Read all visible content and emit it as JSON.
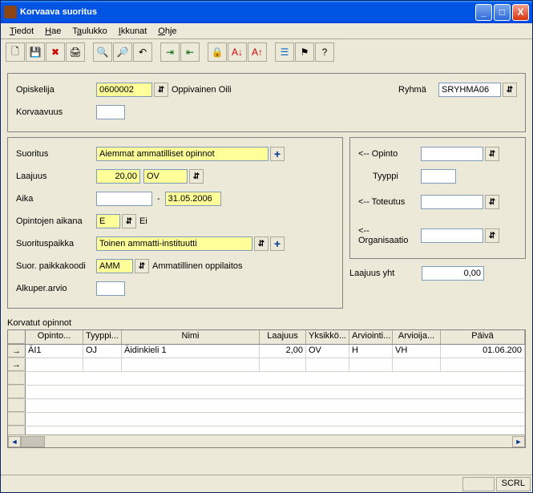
{
  "window": {
    "title": "Korvaava suoritus"
  },
  "menu": {
    "tiedot": "Tiedot",
    "hae": "Hae",
    "taulukko": "Taulukko",
    "ikkunat": "Ikkunat",
    "ohje": "Ohje"
  },
  "top": {
    "opiskelija_lbl": "Opiskelija",
    "opiskelija_val": "0600002",
    "opiskelija_name": "Oppivainen Oili",
    "ryhma_lbl": "Ryhmä",
    "ryhma_val": "SRYHMÄ06",
    "korvaavuus_lbl": "Korvaavuus",
    "korvaavuus_val": ""
  },
  "left": {
    "suoritus_lbl": "Suoritus",
    "suoritus_val": "Aiemmat ammatilliset opinnot",
    "laajuus_lbl": "Laajuus",
    "laajuus_val": "20,00",
    "laajuus_unit": "OV",
    "aika_lbl": "Aika",
    "aika_from": "",
    "aika_sep": "-",
    "aika_to": "31.05.2006",
    "opintojen_lbl": "Opintojen aikana",
    "opintojen_val": "E",
    "opintojen_txt": "Ei",
    "suorituspaikka_lbl": "Suorituspaikka",
    "suorituspaikka_val": "Toinen ammatti-instituutti",
    "paikkakoodi_lbl": "Suor. paikkakoodi",
    "paikkakoodi_val": "AMM",
    "paikkakoodi_txt": "Ammatillinen oppilaitos",
    "alkuper_lbl": "Alkuper.arvio",
    "alkuper_val": ""
  },
  "right": {
    "opinto_lbl": "<-- Opinto",
    "opinto_val": "",
    "tyyppi_lbl": "Tyyppi",
    "tyyppi_val": "",
    "toteutus_lbl": "<-- Toteutus",
    "toteutus_val": "",
    "organisaatio_lbl": "<-- Organisaatio",
    "organisaatio_val": "",
    "laajuus_yht_lbl": "Laajuus yht",
    "laajuus_yht_val": "0,00"
  },
  "table": {
    "title": "Korvatut opinnot",
    "cols": [
      "Opinto...",
      "Tyyppi...",
      "Nimi",
      "Laajuus",
      "Yksikkö...",
      "Arviointi...",
      "Arvioija...",
      "Päivä"
    ],
    "rows": [
      {
        "opinto": "ÄI1",
        "tyyppi": "OJ",
        "nimi": "Äidinkieli 1",
        "laajuus": "2,00",
        "yksikko": "OV",
        "arviointi": "H",
        "arvioija": "VH",
        "paiva": "01.06.200"
      }
    ]
  },
  "status": {
    "scrl": "SCRL"
  }
}
